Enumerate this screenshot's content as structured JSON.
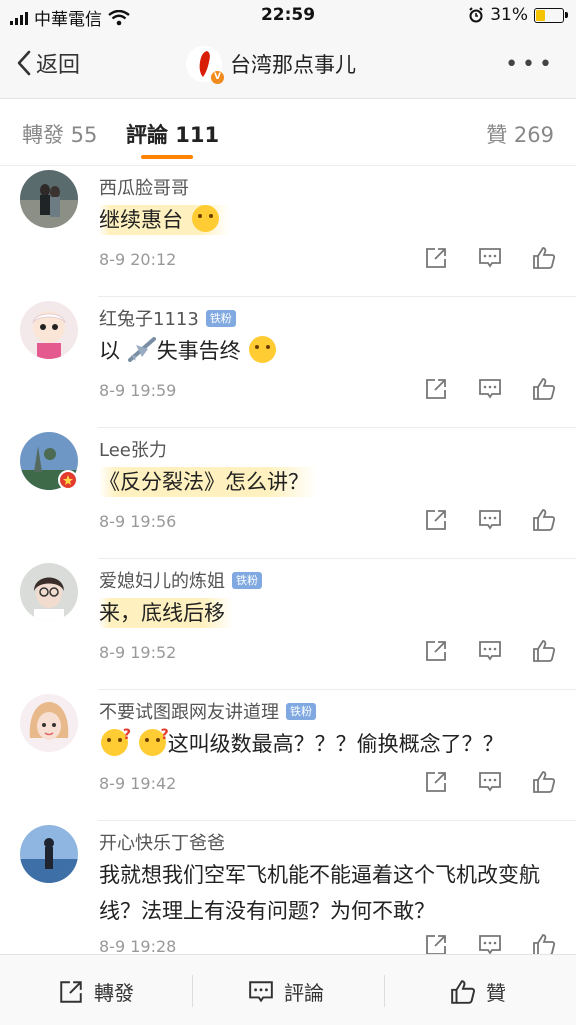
{
  "status": {
    "carrier": "中華電信",
    "time": "22:59",
    "battery": "31%"
  },
  "nav": {
    "back_label": "返回",
    "title": "台湾那点事儿"
  },
  "tabs": {
    "repost": "轉發 55",
    "comment": "評論 111",
    "like": "贊 269"
  },
  "comments": [
    {
      "user": "西瓜脸哥哥",
      "badge": "",
      "text": "继续惠台",
      "time": "8-9 20:12"
    },
    {
      "user": "红兔子1113",
      "badge": "铁粉",
      "text_before": "以",
      "text_after": "失事告终",
      "time": "8-9 19:59"
    },
    {
      "user": "Lee张力",
      "badge": "",
      "text": "《反分裂法》怎么讲？",
      "time": "8-9 19:56"
    },
    {
      "user": "爱媳妇儿的炼姐",
      "badge": "铁粉",
      "text": "来，底线后移",
      "time": "8-9 19:52"
    },
    {
      "user": "不要试图跟网友讲道理",
      "badge": "铁粉",
      "text": "这叫级数最高？？？偷换概念了？？",
      "time": "8-9 19:42"
    },
    {
      "user": "开心快乐丁爸爸",
      "badge": "",
      "text": "我就想我们空军飞机能不能逼着这个飞机改变航线？法理上有没有问题？为何不敢？",
      "time": "8-9 19:28"
    }
  ],
  "bottom": {
    "repost": "轉發",
    "comment": "評論",
    "like": "贊"
  },
  "colors": {
    "accent": "#ff8200",
    "badge": "#7fa9e0"
  }
}
